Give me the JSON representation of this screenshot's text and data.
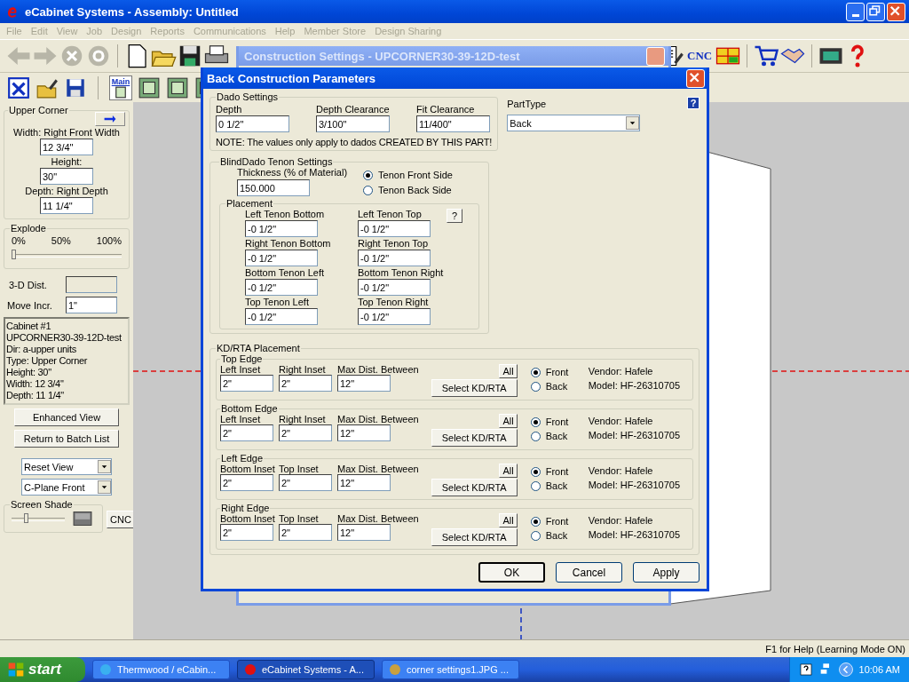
{
  "window": {
    "title": "eCabinet Systems - Assembly: Untitled"
  },
  "menu": [
    {
      "label": "File",
      "disabled": true
    },
    {
      "label": "Edit",
      "disabled": true
    },
    {
      "label": "View",
      "disabled": true
    },
    {
      "label": "Job",
      "disabled": true
    },
    {
      "label": "Design",
      "disabled": true
    },
    {
      "label": "Reports",
      "disabled": true
    },
    {
      "label": "Communications",
      "disabled": true
    },
    {
      "label": "Help",
      "disabled": true
    },
    {
      "label": "Member Store",
      "disabled": true
    },
    {
      "label": "Design Sharing",
      "disabled": true
    }
  ],
  "toolbar": {
    "cnc_label": "CNC"
  },
  "toolbar2": {
    "main_label": "Main"
  },
  "left_panel": {
    "group_title": "Upper Corner",
    "fields": [
      {
        "label": "Width: Right Front Width",
        "value": "12 3/4\""
      },
      {
        "label": "Height:",
        "value": "30\""
      },
      {
        "label": "Depth: Right Depth",
        "value": "11 1/4\""
      }
    ],
    "explode": {
      "title": "Explode",
      "ticks": [
        "0%",
        "50%",
        "100%"
      ],
      "level": 0
    },
    "dist_label": "3-D Dist.",
    "move_label": "Move Incr.",
    "move_value": "1\"",
    "info_lines": [
      "Cabinet #1",
      "UPCORNER30-39-12D-test",
      "Dir: a-upper units",
      "Type: Upper Corner",
      "Height: 30\"",
      "Width: 12 3/4\"",
      "Depth: 11 1/4\""
    ],
    "buttons": [
      "Enhanced View",
      "Return to Batch List"
    ],
    "dropdowns": [
      "Reset View",
      "C-Plane Front"
    ],
    "shade": {
      "title": "Screen Shade",
      "level": 0.25
    },
    "cnc_button": "CNC"
  },
  "back_window": {
    "title": "Construction Settings - UPCORNER30-39-12D-test"
  },
  "dialog": {
    "title": "Back Construction Parameters",
    "help": "?",
    "dado": {
      "title": "Dado Settings",
      "fields": [
        {
          "label": "Depth",
          "value": "0 1/2\""
        },
        {
          "label": "Depth Clearance",
          "value": "3/100\""
        },
        {
          "label": "Fit Clearance",
          "value": "11/400\""
        }
      ],
      "note": "NOTE: The values only apply to dados CREATED BY THIS PART!"
    },
    "part_type": {
      "label": "PartType",
      "value": "Back"
    },
    "tenon": {
      "title": "BlindDado Tenon Settings",
      "thickness_label": "Thickness (% of Material)",
      "thickness_value": "150.000",
      "sides": [
        {
          "label": "Tenon Front Side",
          "selected": true
        },
        {
          "label": "Tenon Back Side",
          "selected": false
        }
      ],
      "placement": {
        "title": "Placement",
        "help": "?",
        "fields": [
          {
            "label": "Left Tenon Bottom",
            "value": "-0 1/2\""
          },
          {
            "label": "Left Tenon Top",
            "value": "-0 1/2\""
          },
          {
            "label": "Right Tenon Bottom",
            "value": "-0 1/2\""
          },
          {
            "label": "Right Tenon Top",
            "value": "-0 1/2\""
          },
          {
            "label": "Bottom Tenon Left",
            "value": "-0 1/2\""
          },
          {
            "label": "Bottom Tenon Right",
            "value": "-0 1/2\""
          },
          {
            "label": "Top Tenon Left",
            "value": "-0 1/2\""
          },
          {
            "label": "Top Tenon Right",
            "value": "-0 1/2\""
          }
        ]
      }
    },
    "kd": {
      "title": "KD/RTA Placement",
      "edges": [
        {
          "title": "Top Edge",
          "fields": [
            {
              "label": "Left Inset",
              "value": "2\""
            },
            {
              "label": "Right Inset",
              "value": "2\""
            },
            {
              "label": "Max Dist. Between",
              "value": "12\""
            }
          ],
          "all": "All",
          "select": "Select KD/RTA",
          "options": [
            {
              "label": "Front",
              "selected": true
            },
            {
              "label": "Back",
              "selected": false
            }
          ],
          "vendor": "Vendor: Hafele",
          "model": "Model: HF-26310705"
        },
        {
          "title": "Bottom Edge",
          "fields": [
            {
              "label": "Left Inset",
              "value": "2\""
            },
            {
              "label": "Right Inset",
              "value": "2\""
            },
            {
              "label": "Max Dist. Between",
              "value": "12\""
            }
          ],
          "all": "All",
          "select": "Select KD/RTA",
          "options": [
            {
              "label": "Front",
              "selected": true
            },
            {
              "label": "Back",
              "selected": false
            }
          ],
          "vendor": "Vendor: Hafele",
          "model": "Model: HF-26310705"
        },
        {
          "title": "Left Edge",
          "fields": [
            {
              "label": "Bottom Inset",
              "value": "2\""
            },
            {
              "label": "Top Inset",
              "value": "2\""
            },
            {
              "label": "Max Dist. Between",
              "value": "12\""
            }
          ],
          "all": "All",
          "select": "Select KD/RTA",
          "options": [
            {
              "label": "Front",
              "selected": true
            },
            {
              "label": "Back",
              "selected": false
            }
          ],
          "vendor": "Vendor: Hafele",
          "model": "Model: HF-26310705"
        },
        {
          "title": "Right Edge",
          "fields": [
            {
              "label": "Bottom Inset",
              "value": "2\""
            },
            {
              "label": "Top Inset",
              "value": "2\""
            },
            {
              "label": "Max Dist. Between",
              "value": "12\""
            }
          ],
          "all": "All",
          "select": "Select KD/RTA",
          "options": [
            {
              "label": "Front",
              "selected": true
            },
            {
              "label": "Back",
              "selected": false
            }
          ],
          "vendor": "Vendor: Hafele",
          "model": "Model: HF-26310705"
        }
      ]
    },
    "buttons": [
      {
        "label": "OK",
        "default": true
      },
      {
        "label": "Cancel",
        "default": false
      },
      {
        "label": "Apply",
        "default": false
      }
    ]
  },
  "status_bar": {
    "text": "F1 for Help (Learning Mode ON)"
  },
  "taskbar": {
    "start": "start",
    "tasks": [
      {
        "label": "Thermwood / eCabin...",
        "selected": false
      },
      {
        "label": "eCabinet Systems - A...",
        "selected": true
      },
      {
        "label": "corner settings1.JPG ...",
        "selected": false
      }
    ],
    "clock": "10:06 AM"
  }
}
